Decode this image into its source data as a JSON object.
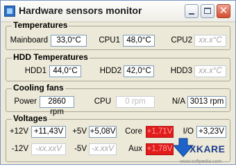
{
  "window": {
    "title": "Hardware sensors monitor",
    "icon": "monitor-app-icon",
    "buttons": {
      "minimize": "minimize-icon",
      "maximize": "maximize-icon",
      "close": "close-icon"
    },
    "close_glyph": "✕"
  },
  "temperatures": {
    "title": "Temperatures",
    "mainboard": {
      "label": "Mainboard",
      "value": "33,0°C"
    },
    "cpu1": {
      "label": "CPU1",
      "value": "48,0°C"
    },
    "cpu2": {
      "label": "CPU2",
      "value": "xx.x°C"
    }
  },
  "hdd": {
    "title": "HDD Temperatures",
    "hdd1": {
      "label": "HDD1",
      "value": "44,0°C"
    },
    "hdd2": {
      "label": "HDD2",
      "value": "42,0°C"
    },
    "hdd3": {
      "label": "HDD3",
      "value": "xx.x°C"
    }
  },
  "fans": {
    "title": "Cooling fans",
    "power": {
      "label": "Power",
      "value": "2860 rpm"
    },
    "cpu": {
      "label": "CPU",
      "value": "0 rpm"
    },
    "na": {
      "label": "N/A",
      "value": "3013 rpm"
    }
  },
  "voltages": {
    "title": "Voltages",
    "p12": {
      "label": "+12V",
      "value": "+11,43V"
    },
    "p5": {
      "label": "+5V",
      "value": "+5,08V"
    },
    "core": {
      "label": "Core",
      "value": "+1,71V"
    },
    "io": {
      "label": "I/O",
      "value": "+3,23V"
    },
    "m12": {
      "label": "-12V",
      "value": "-xx.xxV"
    },
    "m5": {
      "label": "-5V",
      "value": "-x.xxV"
    },
    "aux": {
      "label": "Aux",
      "value": "+1,78V"
    }
  },
  "colors": {
    "alert": "#e21b1b",
    "window_bg": "#ece9d8",
    "close_button": "#d44e2f"
  },
  "watermark": {
    "brand": "XKARE",
    "site": "www.softpedia.com"
  }
}
